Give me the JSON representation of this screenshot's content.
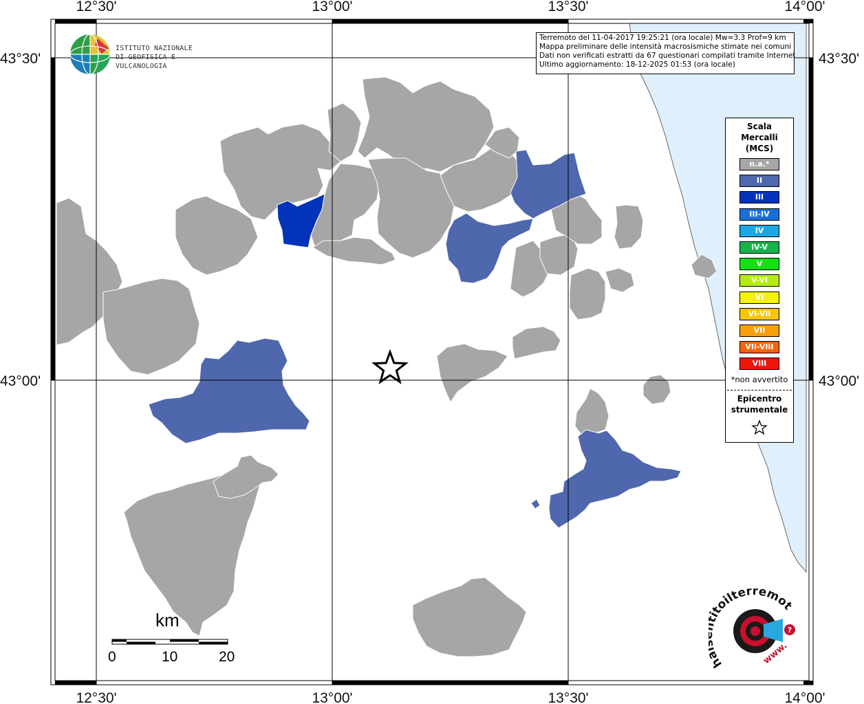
{
  "info": {
    "line1": "Terremoto del 11-04-2017 19:25:21 (ora locale) Mw=3.3 Prof=9 km",
    "line2": "Mappa preliminare delle intensità macrosismiche stimate nei comuni",
    "line3": "Dati non verificati estratti da 67 questionari compilati tramite Internet.",
    "line4": "Ultimo aggiornamento: 18-12-2025 01:53 (ora locale)"
  },
  "axes": {
    "top": [
      "12°30'",
      "13°00'",
      "13°30'",
      "14°00'"
    ],
    "bottom": [
      "12°30'",
      "13°00'",
      "13°30'",
      "14°00'"
    ],
    "left": [
      "43°30'",
      "43°00'"
    ],
    "right": [
      "43°30'",
      "43°00'"
    ]
  },
  "legend": {
    "title_l1": "Scala",
    "title_l2": "Mercalli",
    "title_l3": "(MCS)",
    "items": [
      {
        "label": "n.a.*",
        "color": "#a6a6a6"
      },
      {
        "label": "II",
        "color": "#4f67ad"
      },
      {
        "label": "III",
        "color": "#0333b8"
      },
      {
        "label": "III-IV",
        "color": "#1a6fd6"
      },
      {
        "label": "IV",
        "color": "#1ba6e6"
      },
      {
        "label": "IV-V",
        "color": "#17b44a"
      },
      {
        "label": "V",
        "color": "#12e012"
      },
      {
        "label": "V-VI",
        "color": "#b4ec12"
      },
      {
        "label": "VI",
        "color": "#f5f20b"
      },
      {
        "label": "VI-VII",
        "color": "#f6c40b"
      },
      {
        "label": "VII",
        "color": "#f5a00b"
      },
      {
        "label": "VII-VIII",
        "color": "#f2650b"
      },
      {
        "label": "VIII",
        "color": "#ee160b"
      }
    ],
    "note": "*non avvertito",
    "epi_l1": "Epicentro",
    "epi_l2": "strumentale"
  },
  "logo": {
    "line1": "ISTITUTO NAZIONALE",
    "line2": "DI GEOFISICA E VULCANOLOGIA"
  },
  "scale": {
    "unit": "km",
    "ticks": [
      "0",
      "10",
      "20"
    ]
  },
  "colors": {
    "not_felt": "#a6a6a6",
    "intensity_II": "#4f67ad",
    "intensity_III": "#0333b8",
    "sea": "#dff0fc",
    "coast": "#666666"
  },
  "hsit": {
    "brand": "haisentitoilterremoto.it",
    "prefix": "www."
  }
}
